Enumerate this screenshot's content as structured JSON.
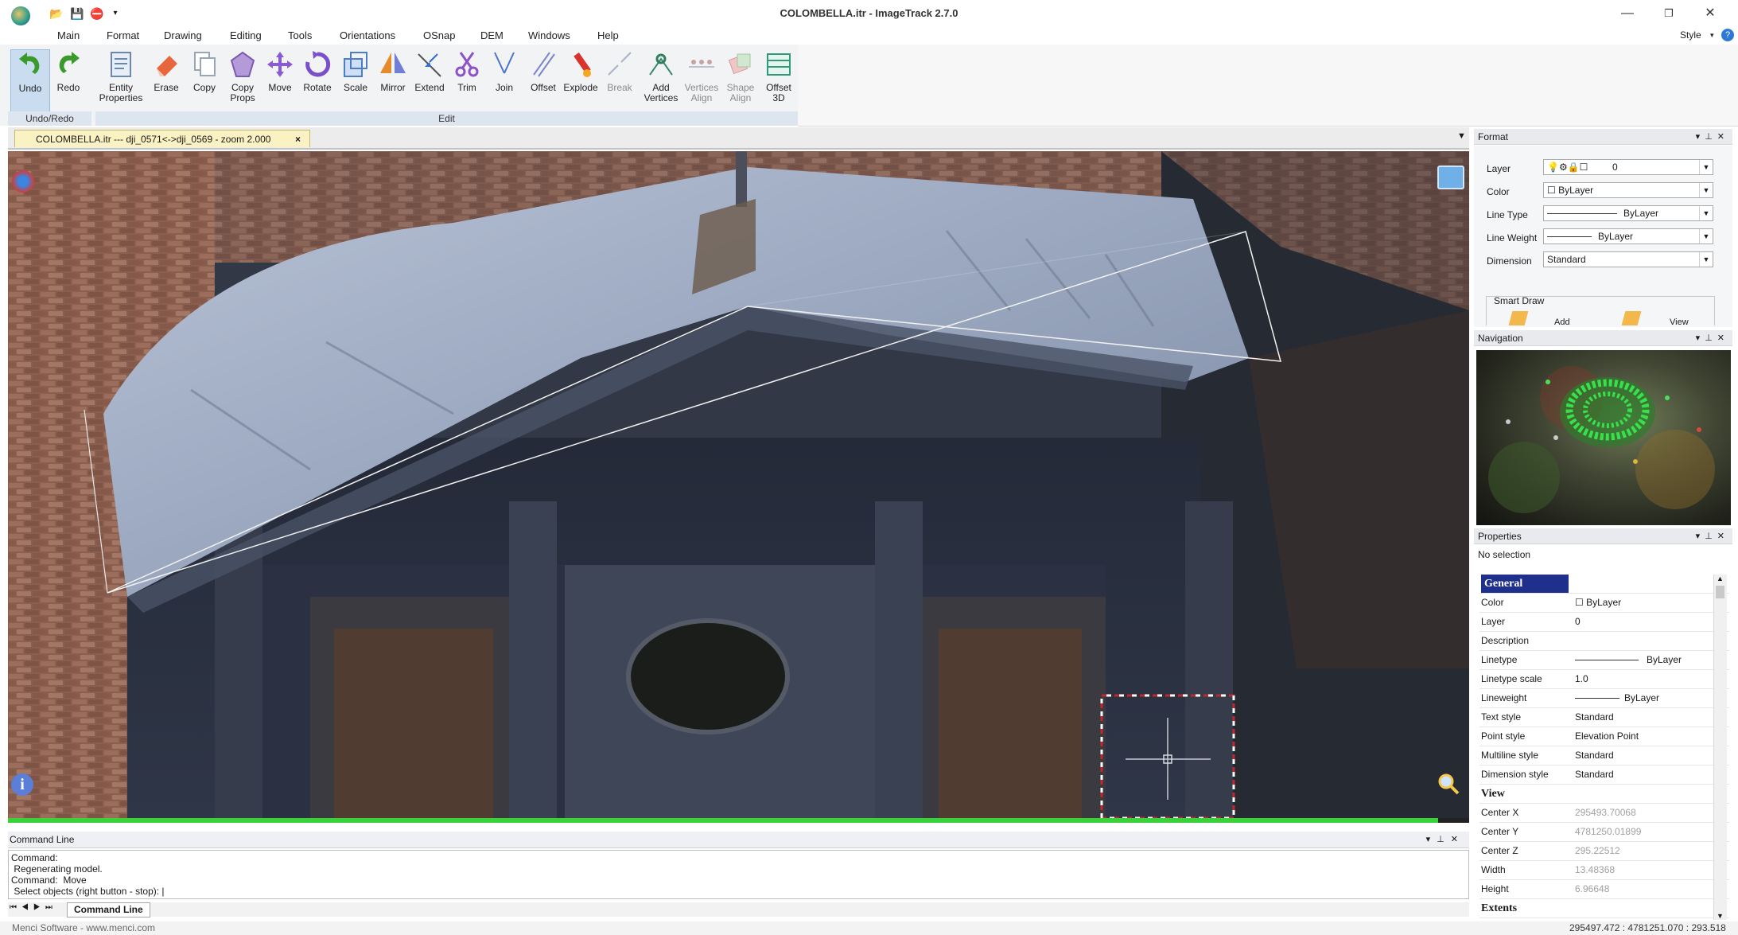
{
  "title_bar": {
    "title": "COLOMBELLA.itr - ImageTrack 2.7.0",
    "right_label": "Style"
  },
  "menu": [
    "Main",
    "Format",
    "Drawing",
    "Editing",
    "Tools",
    "Orientations",
    "OSnap",
    "DEM",
    "Windows",
    "Help"
  ],
  "ribbon": {
    "undo_redo": [
      {
        "label": "Undo"
      },
      {
        "label": "Redo"
      }
    ],
    "undo_group_label": "Undo/Redo",
    "edit_buttons": [
      {
        "label": "Entity Properties"
      },
      {
        "label": "Erase"
      },
      {
        "label": "Copy"
      },
      {
        "label": "Copy Props"
      },
      {
        "label": "Move"
      },
      {
        "label": "Rotate"
      },
      {
        "label": "Scale"
      },
      {
        "label": "Mirror"
      },
      {
        "label": "Extend"
      },
      {
        "label": "Trim"
      },
      {
        "label": "Join"
      },
      {
        "label": "Offset"
      },
      {
        "label": "Explode"
      },
      {
        "label": "Break"
      },
      {
        "label": "Add Vertices"
      },
      {
        "label": "Vertices Align"
      },
      {
        "label": "Shape Align"
      },
      {
        "label": "Offset 3D"
      }
    ],
    "edit_group_label": "Edit"
  },
  "document_tab": {
    "label": "COLOMBELLA.itr --- dji_0571<->dji_0569 - zoom 2.000",
    "close": "×"
  },
  "command_line": {
    "header": "Command Line",
    "lines": [
      "Command:",
      " Regenerating model.",
      "Command:  Move",
      " Select objects (right button - stop): |"
    ],
    "tab_label": "Command Line"
  },
  "status": {
    "left": "Menci Software - www.menci.com",
    "right": "295497.472 : 4781251.070 : 293.518"
  },
  "format_panel": {
    "header": "Format",
    "rows": [
      {
        "label": "Layer",
        "value": "0"
      },
      {
        "label": "Color",
        "value": "ByLayer"
      },
      {
        "label": "Line Type",
        "value": "ByLayer"
      },
      {
        "label": "Line Weight",
        "value": "ByLayer"
      },
      {
        "label": "Dimension",
        "value": "Standard"
      }
    ],
    "smart_draw": {
      "title": "Smart Draw",
      "add": "Add",
      "view": "View"
    }
  },
  "navigation_panel": {
    "header": "Navigation"
  },
  "properties_panel": {
    "header": "Properties",
    "selection": "No selection",
    "general_title": "General",
    "general": [
      {
        "key": "Color",
        "value": "ByLayer"
      },
      {
        "key": "Layer",
        "value": "0"
      },
      {
        "key": "Description",
        "value": ""
      },
      {
        "key": "Linetype",
        "value": "ByLayer"
      },
      {
        "key": "Linetype scale",
        "value": "1.0"
      },
      {
        "key": "Lineweight",
        "value": "ByLayer"
      },
      {
        "key": "Text style",
        "value": "Standard"
      },
      {
        "key": "Point style",
        "value": "Elevation Point"
      },
      {
        "key": "Multiline style",
        "value": "Standard"
      },
      {
        "key": "Dimension style",
        "value": "Standard"
      }
    ],
    "view_title": "View",
    "view": [
      {
        "key": "Center X",
        "value": "295493.70068"
      },
      {
        "key": "Center Y",
        "value": "4781250.01899"
      },
      {
        "key": "Center Z",
        "value": "295.22512"
      },
      {
        "key": "Width",
        "value": "13.48368"
      },
      {
        "key": "Height",
        "value": "6.96648"
      }
    ],
    "extents_title": "Extents"
  },
  "colors": {
    "accent_blue": "#1f2f8c",
    "progress_green": "#39d23a",
    "selection_red": "#c0282d"
  }
}
